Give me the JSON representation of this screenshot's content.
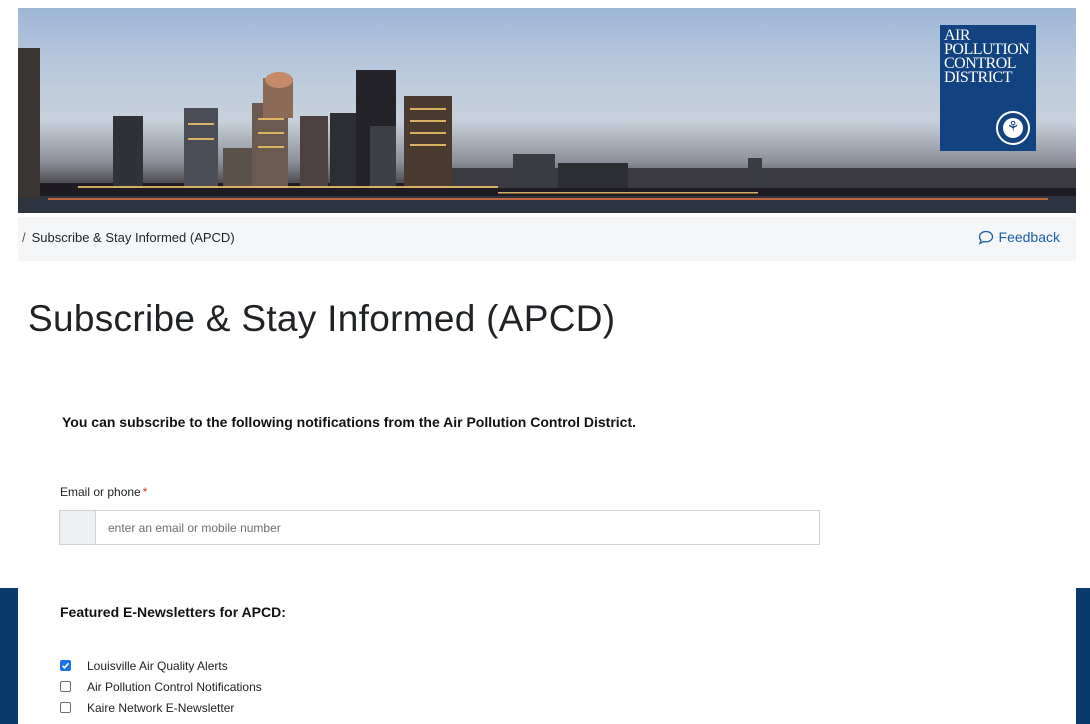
{
  "banner": {
    "logo_lines": [
      "AIR",
      "POLLUTION",
      "CONTROL",
      "DISTRICT"
    ],
    "seal_text": "LOUISVILLE"
  },
  "breadcrumb": {
    "separator": "/",
    "current": "Subscribe & Stay Informed (APCD)"
  },
  "feedback": {
    "label": "Feedback",
    "icon": "speech-bubble-icon"
  },
  "page": {
    "title": "Subscribe & Stay Informed (APCD)",
    "intro": "You can subscribe to the following notifications from the Air Pollution Control District."
  },
  "form": {
    "label": "Email or phone",
    "required_mark": "*",
    "placeholder": "enter an email or mobile number",
    "value": ""
  },
  "newsletters": {
    "title": "Featured E-Newsletters for APCD:",
    "items": [
      {
        "label": "Louisville Air Quality Alerts",
        "checked": true
      },
      {
        "label": "Air Pollution Control Notifications",
        "checked": false
      },
      {
        "label": "Kaire Network E-Newsletter",
        "checked": false
      }
    ]
  },
  "colors": {
    "logo_blue": "#12427f",
    "link_blue": "#1a5fa8",
    "checkbox_blue": "#1a73e8",
    "side_band": "#0b3a6e"
  }
}
